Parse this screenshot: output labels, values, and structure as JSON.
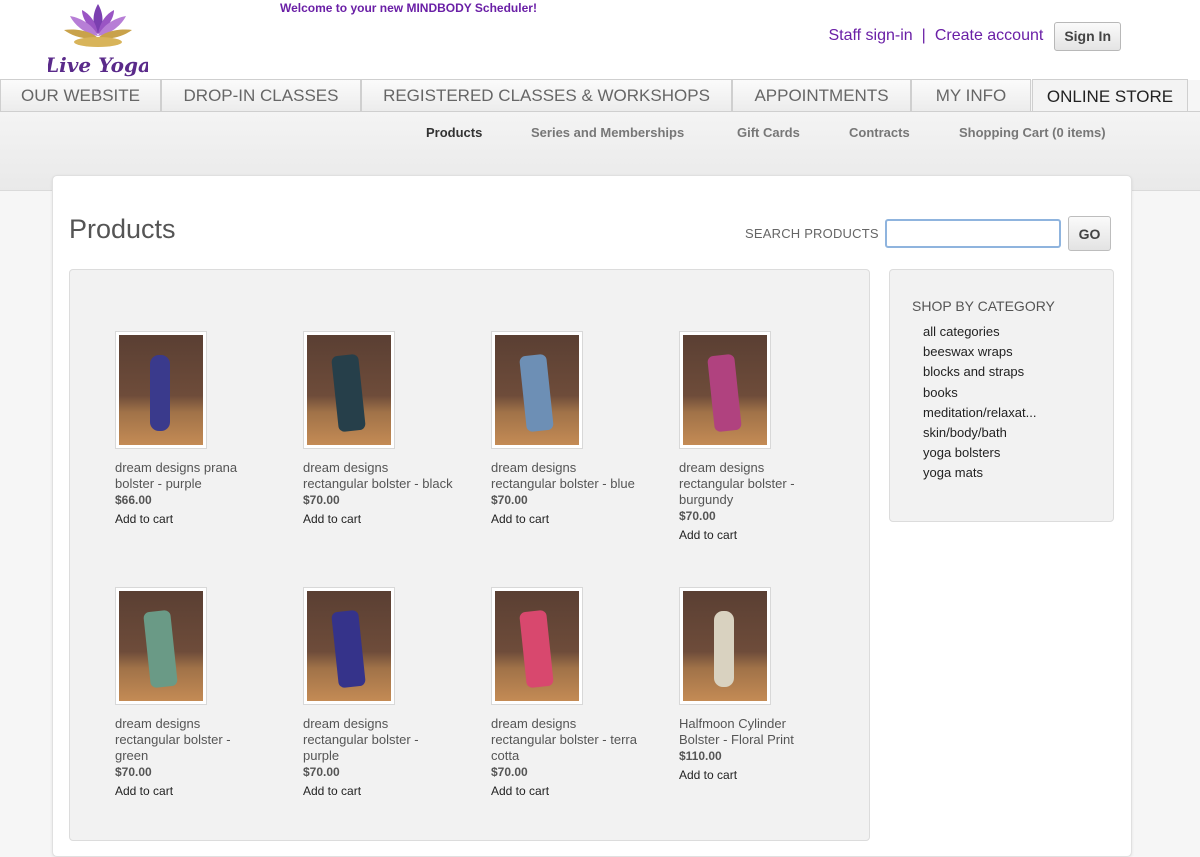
{
  "header": {
    "logo_text": "Live Yoga",
    "welcome": "Welcome to your new MINDBODY Scheduler!",
    "staff_signin": "Staff sign-in",
    "separator": "|",
    "create_account": "Create account",
    "sign_in": "Sign In",
    "brand_color": "#6a1fa6"
  },
  "tabs": [
    {
      "label": "OUR WEBSITE",
      "active": false
    },
    {
      "label": "DROP-IN CLASSES",
      "active": false
    },
    {
      "label": "REGISTERED CLASSES & WORKSHOPS",
      "active": false
    },
    {
      "label": "APPOINTMENTS",
      "active": false
    },
    {
      "label": "MY INFO",
      "active": false
    },
    {
      "label": "ONLINE STORE",
      "active": true
    }
  ],
  "subnav": [
    {
      "label": "Products",
      "active": true
    },
    {
      "label": "Series and Memberships",
      "active": false
    },
    {
      "label": "Gift Cards",
      "active": false
    },
    {
      "label": "Contracts",
      "active": false
    },
    {
      "label": "Shopping Cart (0 items)",
      "active": false
    }
  ],
  "main": {
    "title": "Products",
    "search_label": "SEARCH PRODUCTS",
    "search_value": "",
    "go_label": "GO"
  },
  "products": [
    {
      "name": "dream designs prana bolster - purple",
      "price": "$66.00",
      "action": "Add to cart",
      "color": "#3a3a8c",
      "shape": "round"
    },
    {
      "name": "dream designs rectangular bolster - black",
      "price": "$70.00",
      "action": "Add to cart",
      "color": "#263f4a",
      "shape": "wide"
    },
    {
      "name": "dream designs rectangular bolster - blue",
      "price": "$70.00",
      "action": "Add to cart",
      "color": "#6d8fb5",
      "shape": "wide"
    },
    {
      "name": "dream designs rectangular bolster - burgundy",
      "price": "$70.00",
      "action": "Add to cart",
      "color": "#b0427f",
      "shape": "wide"
    },
    {
      "name": "dream designs rectangular bolster - green",
      "price": "$70.00",
      "action": "Add to cart",
      "color": "#6a9a86",
      "shape": "wide"
    },
    {
      "name": "dream designs rectangular bolster - purple",
      "price": "$70.00",
      "action": "Add to cart",
      "color": "#35338a",
      "shape": "wide"
    },
    {
      "name": "dream designs rectangular bolster - terra cotta",
      "price": "$70.00",
      "action": "Add to cart",
      "color": "#d8486e",
      "shape": "wide"
    },
    {
      "name": "Halfmoon Cylinder Bolster - Floral Print",
      "price": "$110.00",
      "action": "Add to cart",
      "color": "#d9d2c0",
      "shape": "round"
    }
  ],
  "categories": {
    "title": "SHOP BY CATEGORY",
    "items": [
      "all categories",
      "beeswax wraps",
      "blocks and straps",
      "books",
      "meditation/relaxat...",
      "skin/body/bath",
      "yoga bolsters",
      "yoga mats"
    ]
  }
}
